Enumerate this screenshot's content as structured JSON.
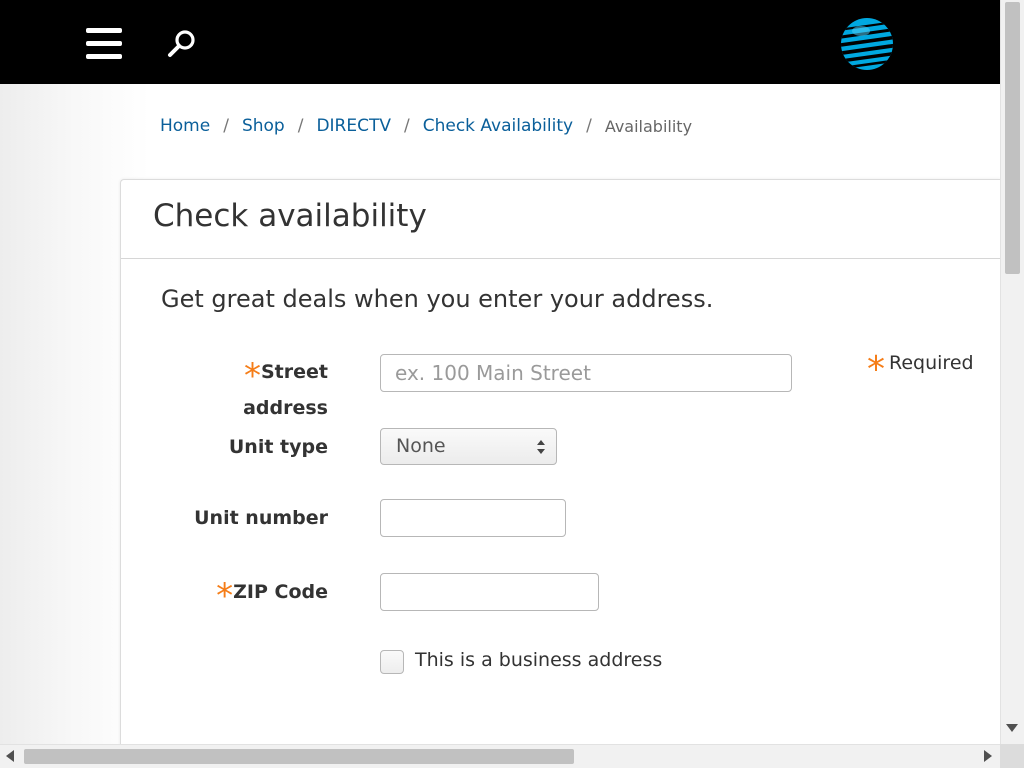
{
  "header": {
    "menu_icon": "hamburger-icon",
    "search_icon": "search-icon",
    "logo_icon": "att-globe-logo",
    "background": "#000000"
  },
  "breadcrumb": {
    "items": [
      "Home",
      "Shop",
      "DIRECTV",
      "Check Availability"
    ],
    "separator": "/",
    "current": "Availability",
    "link_color": "#0a5f9a"
  },
  "form": {
    "title": "Check availability",
    "subtitle": "Get great deals when you enter your address.",
    "required_marker": "*",
    "required_note": "Required",
    "accent_color": "#f57d18",
    "street": {
      "label_line1": "Street",
      "label_line2": "address",
      "placeholder": "ex. 100 Main Street",
      "value": ""
    },
    "unit_type": {
      "label": "Unit type",
      "selected": "None"
    },
    "unit_number": {
      "label": "Unit number",
      "value": ""
    },
    "zip": {
      "label": "ZIP Code",
      "value": ""
    },
    "business": {
      "label": "This is a business address",
      "checked": false
    }
  }
}
